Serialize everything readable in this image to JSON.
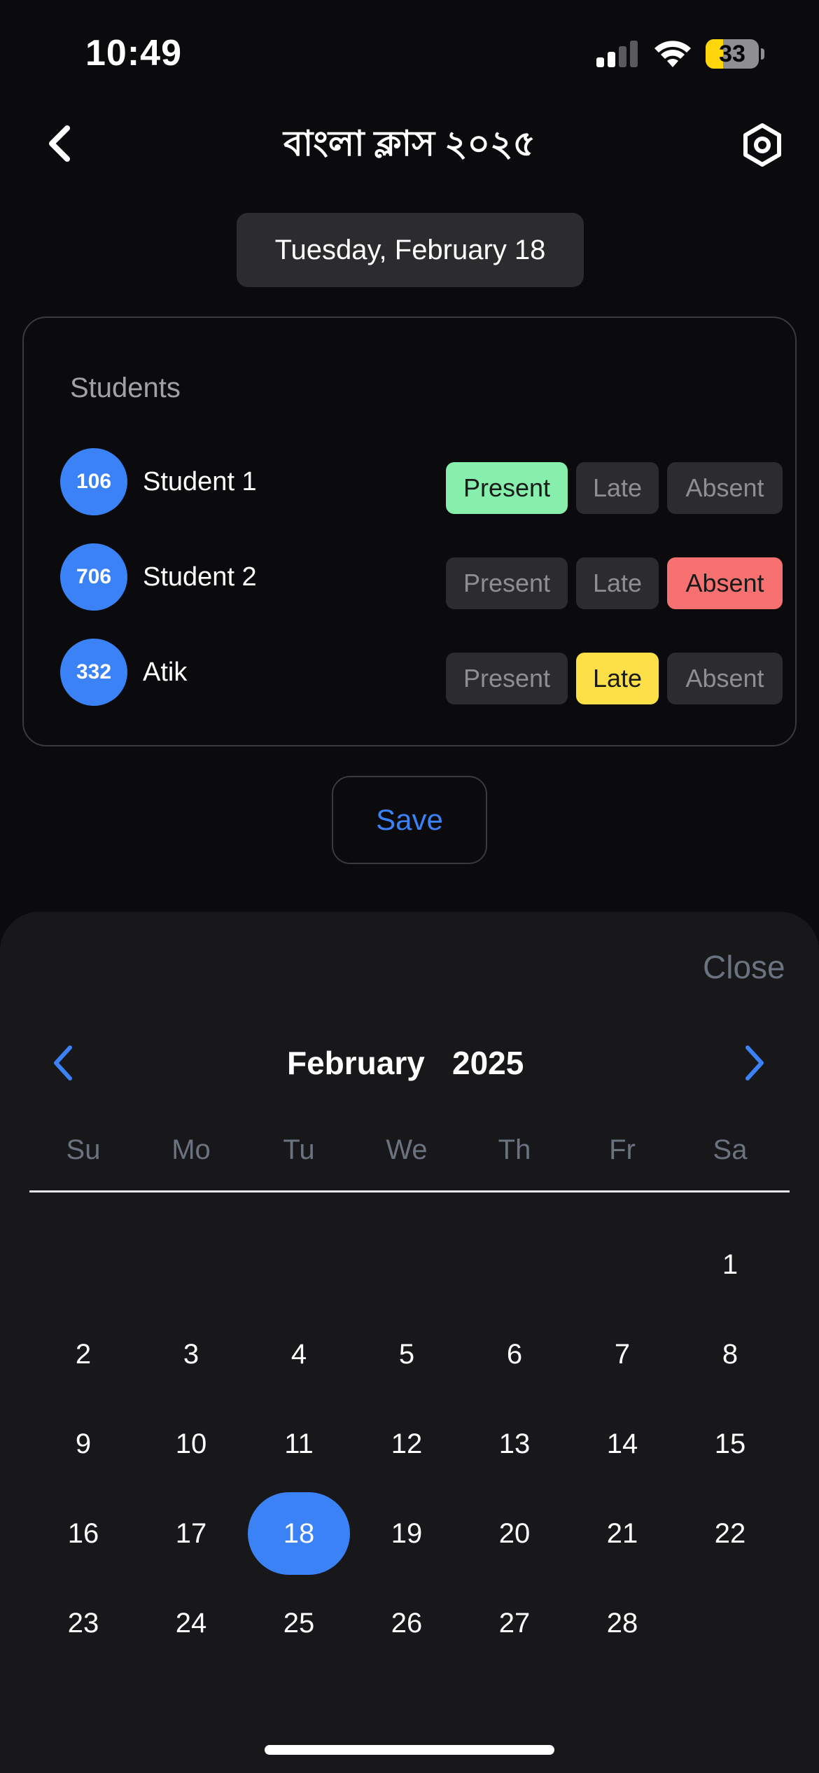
{
  "status_bar": {
    "time": "10:49",
    "battery_percent": "33",
    "battery_level": 0.33
  },
  "header": {
    "title": "বাংলা ক্লাস ২০২৫",
    "back_icon": "chevron-left-icon",
    "settings_icon": "hexagon-settings-icon"
  },
  "selected_date_label": "Tuesday, February 18",
  "students_section": {
    "title": "Students",
    "students": [
      {
        "roll": "106",
        "name": "Student 1",
        "status": "Present"
      },
      {
        "roll": "706",
        "name": "Student 2",
        "status": "Absent"
      },
      {
        "roll": "332",
        "name": "Atik",
        "status": "Late"
      }
    ],
    "status_labels": {
      "present": "Present",
      "late": "Late",
      "absent": "Absent"
    }
  },
  "save_label": "Save",
  "calendar": {
    "close_label": "Close",
    "month": "February",
    "year": "2025",
    "weekdays": [
      "Su",
      "Mo",
      "Tu",
      "We",
      "Th",
      "Fr",
      "Sa"
    ],
    "first_weekday_index": 6,
    "days_in_month": 28,
    "selected_day": 18
  },
  "colors": {
    "accent": "#3b82f6",
    "present": "#86efac",
    "late": "#fde047",
    "absent": "#f87171"
  }
}
